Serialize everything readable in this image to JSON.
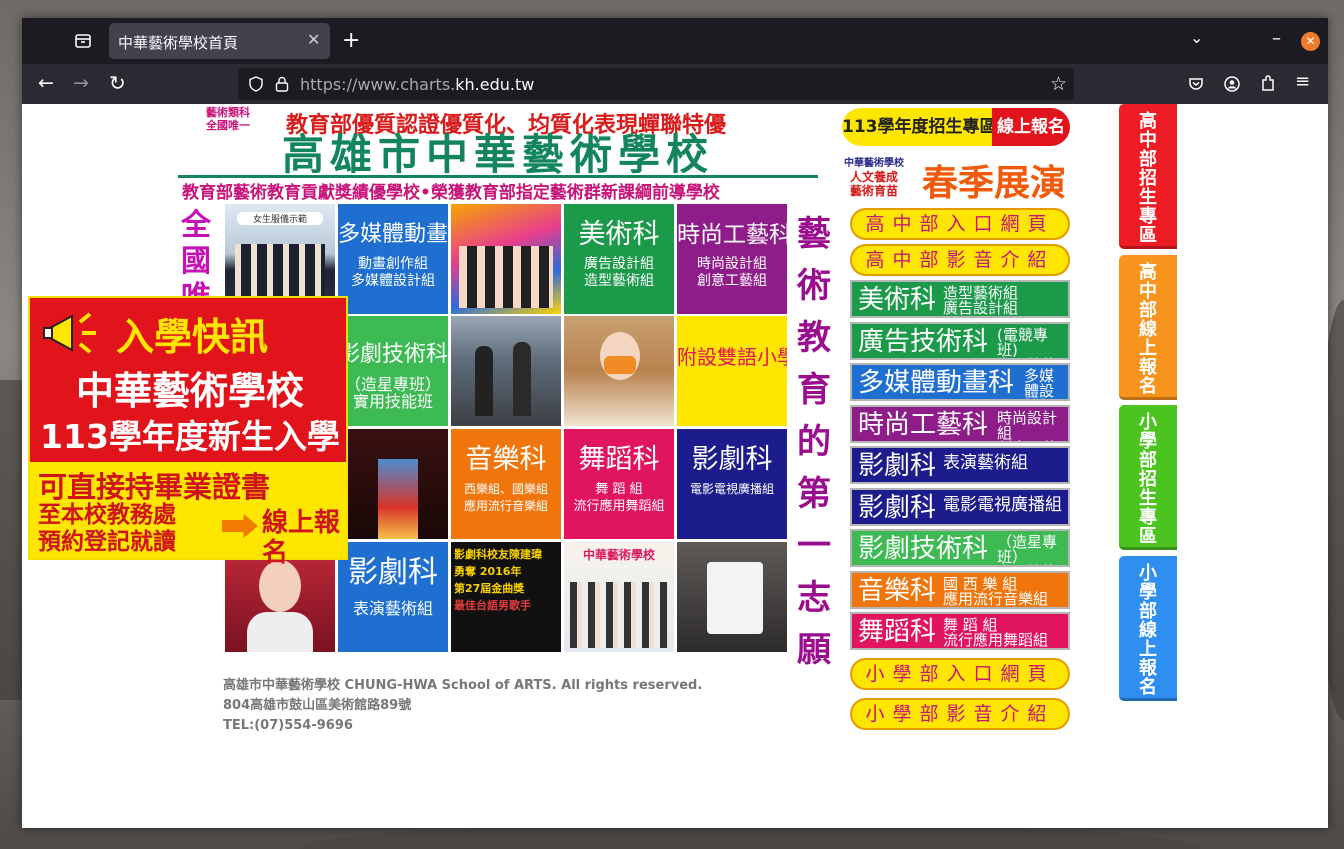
{
  "browser": {
    "tab_title": "中華藝術學校首頁",
    "url_prefix": "https://www.charts.",
    "url_domain": "kh.edu.tw",
    "icons": [
      "tab-list-icon",
      "close-tab-icon",
      "new-tab-icon",
      "list-all-tabs-icon",
      "minimize-icon",
      "close-window-icon",
      "back-icon",
      "forward-icon",
      "reload-icon",
      "shield-icon",
      "lock-icon",
      "bookmark-star-icon",
      "pocket-icon",
      "account-icon",
      "extensions-icon",
      "menu-icon"
    ]
  },
  "header": {
    "badge_top": "藝術類科",
    "badge_bottom": "全國唯一",
    "tagline": "教育部優質認證優質化、均質化表現蟬聯特優",
    "school_name": "高雄市中華藝術學校",
    "subline": "教育部藝術教育貢獻獎績優學校•榮獲教育部指定藝術群新課綱前導學校"
  },
  "vertical_left": "全國唯一藝術學園",
  "vertical_right": "藝術教育的第一志願",
  "tiles": [
    {
      "title": "多媒體動畫科",
      "sub": "動畫創作組\n多媒體設計組",
      "color": "#1e6fcf"
    },
    {
      "title": "美術科",
      "sub": "廣告設計組\n造型藝術組",
      "color": "#1b9a4a"
    },
    {
      "title": "時尚工藝科",
      "sub": "時尚設計組\n創意工藝組",
      "color": "#8e1d8a"
    },
    {
      "title": "影劇技術科",
      "sub": "（造星專班）\n實用技能班",
      "color": "#3dba54"
    },
    {
      "title": "附設雙語小學",
      "sub": "",
      "color": "#ffe600"
    },
    {
      "title": "音樂科",
      "sub": "西樂組、國樂組\n應用流行音樂組",
      "color": "#f0750c"
    },
    {
      "title": "舞蹈科",
      "sub": "舞 蹈 組\n流行應用舞蹈組",
      "color": "#e0155e"
    },
    {
      "title": "影劇科",
      "sub": "電影電視廣播組",
      "color": "#1c1c8c"
    },
    {
      "title": "影劇科",
      "sub": "表演藝術組",
      "color": "#1e6fcf"
    }
  ],
  "photo_labels": {
    "uniform": "女生服儀示範",
    "award_line1": "影劇科校友陳建瑋",
    "award_line2": "勇奪 2016年",
    "award_line3": "第27屆金曲獎",
    "award_line4": "最佳台語男歌手",
    "poster": "中華藝術學校"
  },
  "popup": {
    "title": "入學快訊",
    "line1": "中華藝術學校",
    "line2": "113學年度新生入學",
    "line3": "可直接持畢業證書",
    "line4": "至本校教務處",
    "line5": "預約登記就讀",
    "cta": "線上報名"
  },
  "right": {
    "admissions_label": "113學年度招生專區",
    "online_label": "線上報名",
    "exhibit_small1": "中華藝術學校",
    "exhibit_small2": "人文養成",
    "exhibit_small3": "藝術育苗",
    "exhibit_title": "春季展演",
    "hs_portal": "高中部入口網頁",
    "hs_video": "高中部影音介紹",
    "depts": [
      {
        "name": "美術科",
        "sub": "造型藝術組\n廣告設計組",
        "color": "#1b9a4a"
      },
      {
        "name": "廣告技術科",
        "sub": "(電競專班)\n實用技能班",
        "color": "#1b9a4a"
      },
      {
        "name": "多媒體動畫科",
        "sub": "多媒體設計組\n動 畫 創 作 組",
        "color": "#1e6fcf"
      },
      {
        "name": "時尚工藝科",
        "sub": "時尚設計組\n創意工藝組",
        "color": "#8e1d8a"
      },
      {
        "name": "影劇科",
        "sub": "表演藝術組",
        "color": "#1c1c8c"
      },
      {
        "name": "影劇科",
        "sub": "電影電視廣播組",
        "color": "#1c1c8c"
      },
      {
        "name": "影劇技術科",
        "sub": "（造星專班）\n實用技能班",
        "color": "#3dba54"
      },
      {
        "name": "音樂科",
        "sub": "國 西 樂 組\n應用流行音樂組",
        "color": "#f0750c"
      },
      {
        "name": "舞蹈科",
        "sub": "舞 蹈 組\n流行應用舞蹈組",
        "color": "#e0155e"
      }
    ],
    "es_portal": "小學部入口網頁",
    "es_video": "小學部影音介紹"
  },
  "side_tabs": [
    {
      "label": "高中部招生專區",
      "color": "#ee1c24"
    },
    {
      "label": "高中部線上報名",
      "color": "#f7941d"
    },
    {
      "label": "小學部招生專區",
      "color": "#4cc41f"
    },
    {
      "label": "小學部線上報名",
      "color": "#2e8ff0"
    }
  ],
  "footer": {
    "line1": "高雄市中華藝術學校  CHUNG-HWA School of ARTS. All rights reserved.",
    "line2": "804高雄市鼓山區美術館路89號",
    "line3": "TEL:(07)554-9696"
  }
}
